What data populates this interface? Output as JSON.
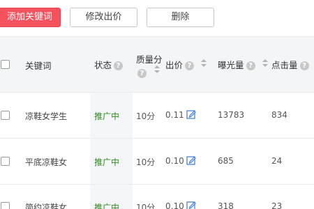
{
  "toolbar": {
    "add_keyword_label": "添加关键词",
    "edit_bid_label": "修改出价",
    "delete_label": "删除"
  },
  "table": {
    "headers": {
      "keyword": "关键词",
      "status": "状态",
      "quality_line1": "质量分",
      "bid": "出价",
      "impressions": "曝光量",
      "clicks": "点击量"
    },
    "rows": [
      {
        "keyword": "凉鞋女学生",
        "status": "推广中",
        "quality": "10分",
        "bid": "0.11",
        "impressions": "13783",
        "clicks": "834"
      },
      {
        "keyword": "平底凉鞋女",
        "status": "推广中",
        "quality": "10分",
        "bid": "0.10",
        "impressions": "685",
        "clicks": "24"
      },
      {
        "keyword": "简约凉鞋女",
        "status": "推广中",
        "quality": "10分",
        "bid": "0.10",
        "impressions": "318",
        "clicks": "23"
      }
    ]
  },
  "icons": {
    "help": "help-circle-icon",
    "sort": "sort-icon",
    "edit": "pencil-edit-icon"
  },
  "colors": {
    "primary_button": "#f4525e",
    "status_active": "#2e8b1e",
    "edit_icon": "#3a7bd5",
    "header_bg": "#f3f5f7"
  }
}
